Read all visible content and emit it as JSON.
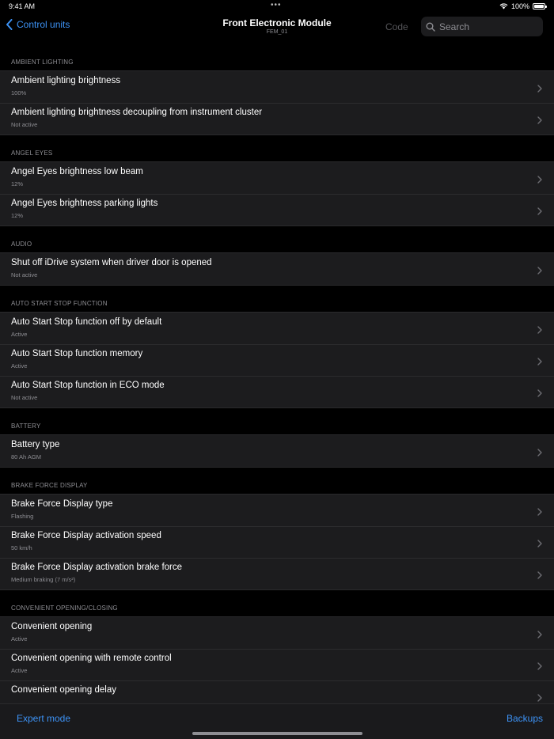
{
  "status_bar": {
    "time": "9:41 AM",
    "dots": "•••",
    "battery": "100%"
  },
  "nav": {
    "back_label": "Control units",
    "title": "Front Electronic Module",
    "subtitle": "FEM_01",
    "code_label": "Code",
    "search_placeholder": "Search"
  },
  "sections": [
    {
      "header": "AMBIENT LIGHTING",
      "rows": [
        {
          "title": "Ambient lighting brightness",
          "value": "100%"
        },
        {
          "title": "Ambient lighting brightness decoupling from instrument cluster",
          "value": "Not active"
        }
      ]
    },
    {
      "header": "ANGEL EYES",
      "rows": [
        {
          "title": "Angel Eyes brightness low beam",
          "value": "12%"
        },
        {
          "title": "Angel Eyes brightness parking lights",
          "value": "12%"
        }
      ]
    },
    {
      "header": "AUDIO",
      "rows": [
        {
          "title": "Shut off iDrive system when driver door is opened",
          "value": "Not active"
        }
      ]
    },
    {
      "header": "AUTO START STOP FUNCTION",
      "rows": [
        {
          "title": "Auto Start Stop function off by default",
          "value": "Active"
        },
        {
          "title": "Auto Start Stop function memory",
          "value": "Active"
        },
        {
          "title": "Auto Start Stop function in ECO mode",
          "value": "Not active"
        }
      ]
    },
    {
      "header": "BATTERY",
      "rows": [
        {
          "title": "Battery type",
          "value": "80 Ah AGM"
        }
      ]
    },
    {
      "header": "BRAKE FORCE DISPLAY",
      "rows": [
        {
          "title": "Brake Force Display type",
          "value": "Flashing"
        },
        {
          "title": "Brake Force Display activation speed",
          "value": "50 km/h"
        },
        {
          "title": "Brake Force Display activation brake force",
          "value": "Medium braking (7 m/s²)"
        }
      ]
    },
    {
      "header": "CONVENIENT OPENING/CLOSING",
      "rows": [
        {
          "title": "Convenient opening",
          "value": "Active"
        },
        {
          "title": "Convenient opening with remote control",
          "value": "Active"
        },
        {
          "title": "Convenient opening delay",
          "value": ""
        }
      ]
    }
  ],
  "toolbar": {
    "left_label": "Expert mode",
    "right_label": "Backups"
  },
  "colors": {
    "accent": "#3d93f6",
    "background": "#000000",
    "cell": "#1c1c1e",
    "secondary_text": "#8e8e93"
  }
}
